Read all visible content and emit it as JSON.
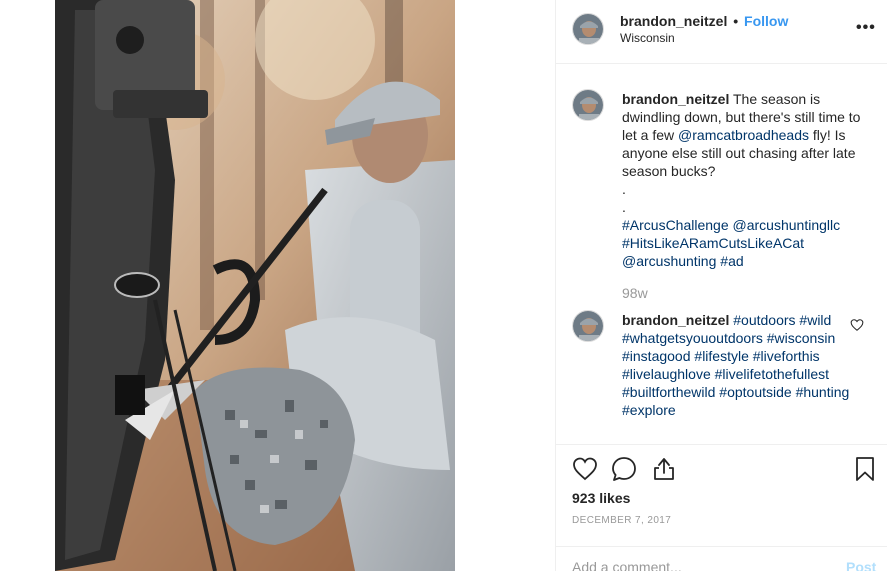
{
  "post": {
    "username": "brandon_neitzel",
    "separator": "•",
    "follow_label": "Follow",
    "location": "Wisconsin",
    "more_label": "•••"
  },
  "caption": {
    "username": "brandon_neitzel",
    "text_1": " The season is dwindling down, but there's still time to let a few ",
    "mention_1": "@ramcatbroadheads",
    "text_2": " fly! Is anyone else still out chasing after late season bucks?",
    "dot_1": ".",
    "dot_2": ".",
    "hashtag_1": "#ArcusChallenge",
    "mention_2": "@arcushuntingllc",
    "hashtag_2": "#HitsLikeARamCutsLikeACat",
    "mention_3": "@arcushunting",
    "hashtag_3": "#ad",
    "time": "98w"
  },
  "comment": {
    "username": "brandon_neitzel",
    "tags": [
      "#outdoors",
      "#wild",
      "#whatgetsyououtdoors",
      "#wisconsin",
      "#instagood",
      "#lifestyle",
      "#liveforthis",
      "#livelaughlove",
      "#livelifetothefullest",
      "#builtforthewild",
      "#optoutside",
      "#hunting",
      "#explore"
    ]
  },
  "actions": {
    "likes": "923 likes",
    "date": "DECEMBER 7, 2017"
  },
  "add_comment": {
    "placeholder": "Add a comment...",
    "post_label": "Post"
  },
  "icons": {
    "like": "heart-icon",
    "comment": "comment-bubble-icon",
    "share": "share-icon",
    "save": "bookmark-icon",
    "comment_like": "heart-icon"
  },
  "colors": {
    "follow": "#3897f0",
    "tag": "#003569",
    "muted": "#999999",
    "post_disabled": "#b2dffc"
  }
}
